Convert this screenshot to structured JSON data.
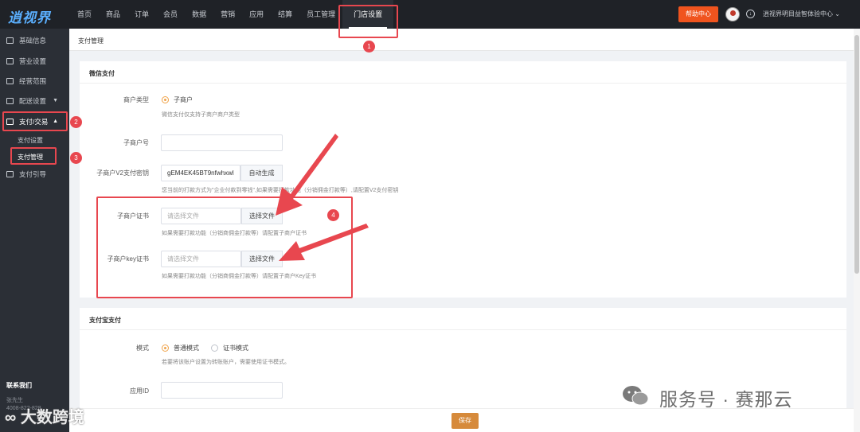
{
  "topbar": {
    "logo": "逍视界",
    "nav": [
      "首页",
      "商品",
      "订单",
      "会员",
      "数据",
      "营销",
      "应用",
      "结算",
      "员工管理"
    ],
    "nav_active": "门店设置",
    "help": "帮助中心",
    "account": "逍视界明目益智体验中心 ⌄"
  },
  "sidebar": {
    "items": [
      "基础信息",
      "营业设置",
      "经营范围",
      "配送设置"
    ],
    "pay_group": "支付/交易",
    "sub": [
      "支付设置",
      "支付管理"
    ],
    "pay_guide": "支付引导",
    "contact_title": "联系我们",
    "contact_person": "张先生",
    "contact_phone": "4008-822-828"
  },
  "page": {
    "title": "支付管理",
    "wechat": {
      "title": "微信支付",
      "merchant_type_label": "商户类型",
      "merchant_type_option": "子商户",
      "merchant_type_hint": "微信支付仅支持子商户商户类型",
      "sub_mch_id_label": "子商户号",
      "sub_mch_id_value": "",
      "v2_key_label": "子商户V2支付密钥",
      "v2_key_value": "gEM4EK45BT9nfwhxwl",
      "auto_generate": "自动生成",
      "v2_key_hint": "您当前的打款方式为\"企业付款到零钱\",如果需要打款功能（分销佣金打款等）,请配置V2支付密钥",
      "cert_label": "子商户证书",
      "cert_placeholder": "请选择文件",
      "cert_button": "选择文件",
      "cert_hint": "如果需要打款功能（分销商佣金打款等）请配置子商户证书",
      "key_cert_label": "子商户key证书",
      "key_cert_placeholder": "请选择文件",
      "key_cert_button": "选择文件",
      "key_cert_hint": "如果需要打款功能（分销商佣金打款等）请配置子商户Key证书"
    },
    "alipay": {
      "title": "支付宝支付",
      "mode_label": "模式",
      "mode_normal": "普通模式",
      "mode_cert": "证书模式",
      "mode_hint": "若要将该账户设置为转账账户，需要使用证书模式。",
      "app_id_label": "应用ID",
      "app_id_value": ""
    },
    "save": "保存"
  },
  "annotations": {
    "b1": "1",
    "b2": "2",
    "b3": "3",
    "b4": "4"
  },
  "watermarks": {
    "right": "服务号 · 赛那云",
    "left": "大数跨境"
  },
  "colors": {
    "accent": "#f0541e",
    "highlight": "#e8474f",
    "save": "#d68a3b",
    "radio": "#f0a44b"
  }
}
